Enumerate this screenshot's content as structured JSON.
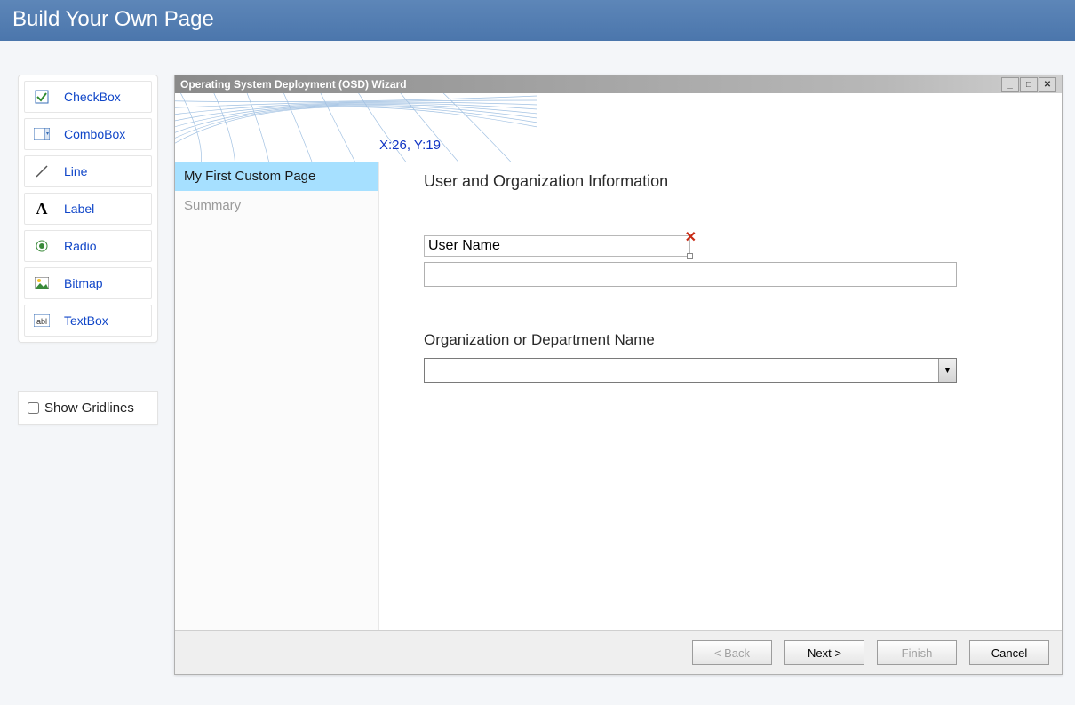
{
  "header": {
    "title": "Build Your Own Page"
  },
  "toolbox": {
    "items": [
      {
        "label": "CheckBox"
      },
      {
        "label": "ComboBox"
      },
      {
        "label": "Line"
      },
      {
        "label": "Label"
      },
      {
        "label": "Radio"
      },
      {
        "label": "Bitmap"
      },
      {
        "label": "TextBox"
      }
    ]
  },
  "gridlines": {
    "label": "Show Gridlines",
    "checked": false
  },
  "wizard": {
    "title": "Operating System Deployment (OSD) Wizard",
    "coords": "X:26, Y:19",
    "nav": {
      "items": [
        {
          "label": "My First Custom Page",
          "active": true
        },
        {
          "label": "Summary",
          "active": false
        }
      ]
    },
    "content": {
      "heading": "User and Organization Information",
      "field1_label": "User Name",
      "field1_value": "",
      "field2_label": "Organization or Department Name",
      "field2_value": ""
    },
    "buttons": {
      "back": "< Back",
      "next": "Next >",
      "finish": "Finish",
      "cancel": "Cancel"
    }
  }
}
